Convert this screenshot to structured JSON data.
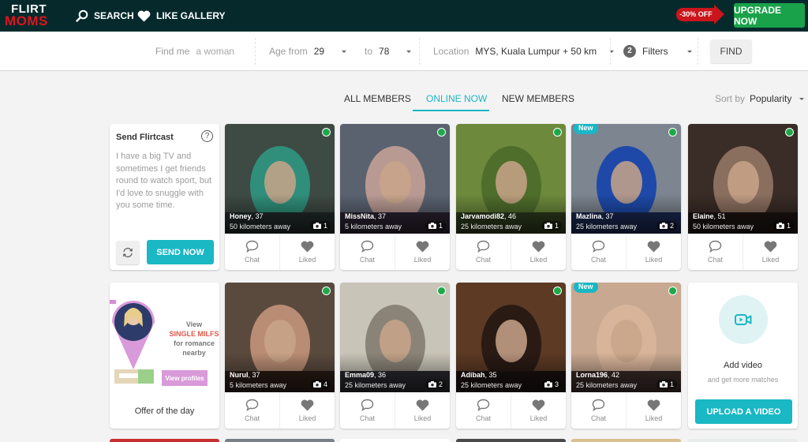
{
  "header": {
    "logo_line1": "FLIRT",
    "logo_line2": "MOMS",
    "nav": [
      {
        "label": "SEARCH",
        "icon": "search-icon"
      },
      {
        "label": "LIKE GALLERY",
        "icon": "heart-icon"
      }
    ],
    "promo": "-30% OFF",
    "upgrade_label": "UPGRADE NOW"
  },
  "search": {
    "find_me_label": "Find me",
    "find_me_value": "a woman",
    "age_from_label": "Age from",
    "age_from_value": "29",
    "age_to_label": "to",
    "age_to_value": "78",
    "location_label": "Location",
    "location_value": "MYS, Kuala Lumpur + 50 km",
    "filters_count": "2",
    "filters_label": "Filters",
    "find_label": "FIND"
  },
  "tabs": [
    {
      "label": "ALL MEMBERS",
      "active": false
    },
    {
      "label": "ONLINE NOW",
      "active": true
    },
    {
      "label": "NEW MEMBERS",
      "active": false
    }
  ],
  "sort": {
    "label": "Sort by",
    "value": "Popularity"
  },
  "flirtcast": {
    "title": "Send Flirtcast",
    "help": "?",
    "message": "I have a big TV and sometimes I get friends round to watch sport, but I'd love to snuggle with you some time.",
    "send_label": "SEND NOW"
  },
  "offer": {
    "line1": "View",
    "highlight": "SINGLE MILFS",
    "line2": "for romance nearby",
    "button": "View profiles",
    "title": "Offer of the day"
  },
  "video": {
    "title": "Add video",
    "subtitle": "and get more matches",
    "button": "UPLOAD A VIDEO"
  },
  "actions": {
    "chat": "Chat",
    "liked": "Liked"
  },
  "profiles": [
    {
      "name": "Honey",
      "age": ", 37",
      "distance": "50 kilometers away",
      "photos": "1",
      "online": true,
      "new": false,
      "colors": [
        "#3e4a44",
        "#2f8f7a",
        "#1f2a28"
      ]
    },
    {
      "name": "MissNita",
      "age": ", 37",
      "distance": "5 kilometers away",
      "photos": "1",
      "online": true,
      "new": false,
      "colors": [
        "#5a6270",
        "#b99a92",
        "#2a2230"
      ]
    },
    {
      "name": "Jarvamodi82",
      "age": ", 46",
      "distance": "25 kilometers away",
      "photos": "1",
      "online": true,
      "new": false,
      "colors": [
        "#6d8a3c",
        "#4f6e2c",
        "#2c3a1c"
      ]
    },
    {
      "name": "Mazlina",
      "age": ", 37",
      "distance": "25 kilometers away",
      "photos": "2",
      "online": true,
      "new": true,
      "colors": [
        "#7c8590",
        "#1e49a8",
        "#1a2850"
      ]
    },
    {
      "name": "Elaine",
      "age": ", 51",
      "distance": "50 kilometers away",
      "photos": "1",
      "online": true,
      "new": false,
      "colors": [
        "#3a2c26",
        "#8a6e5e",
        "#1c1410"
      ]
    },
    {
      "name": "Nurul",
      "age": ", 37",
      "distance": "5 kilometers away",
      "photos": "4",
      "online": true,
      "new": false,
      "colors": [
        "#5a4a3e",
        "#b98c74",
        "#2a1c16"
      ]
    },
    {
      "name": "Emma09",
      "age": ", 36",
      "distance": "25 kilometers away",
      "photos": "2",
      "online": true,
      "new": false,
      "colors": [
        "#c8c4b8",
        "#8a8478",
        "#2a2a30"
      ]
    },
    {
      "name": "Adibah",
      "age": ", 35",
      "distance": "25 kilometers away",
      "photos": "3",
      "online": true,
      "new": false,
      "colors": [
        "#5c3a24",
        "#2a1a14",
        "#1a1210"
      ]
    },
    {
      "name": "Lorna196",
      "age": ", 42",
      "distance": "25 kilometers away",
      "photos": "1",
      "online": true,
      "new": true,
      "colors": [
        "#c8a890",
        "#d8b49a",
        "#3a2c28"
      ]
    }
  ],
  "colors": {
    "accent": "#1ab7c4",
    "online": "#1fa84a",
    "upgrade": "#1aa24a",
    "promo": "#c9151b",
    "header": "#062a2c"
  }
}
